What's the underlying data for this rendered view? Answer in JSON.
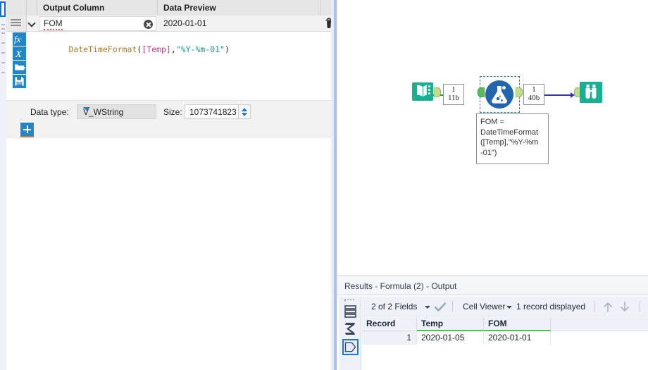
{
  "config_panel": {
    "grid_headers": [
      "Output Column",
      "Data Preview"
    ],
    "row": {
      "output_column": "FOM",
      "data_preview": "2020-01-01",
      "clear_icon": "clear-circle-icon",
      "delete_icon": "trash-icon",
      "expand_icon": "chevron-down-icon",
      "drag_icon": "drag-handle-icon"
    },
    "tool_buttons": [
      {
        "name": "function-button",
        "glyph": "fx"
      },
      {
        "name": "variable-button",
        "glyph": "X"
      },
      {
        "name": "open-folder-button",
        "glyph": "folder"
      },
      {
        "name": "save-button",
        "glyph": "floppy"
      }
    ],
    "formula": {
      "tokens": [
        {
          "text": "DateTimeFormat",
          "kind": "fn"
        },
        {
          "text": "(",
          "kind": "pn"
        },
        {
          "text": "[Temp]",
          "kind": "fld"
        },
        {
          "text": ",",
          "kind": "pn"
        },
        {
          "text": "\"%Y-%m-01\"",
          "kind": "str"
        },
        {
          "text": ")",
          "kind": "pn"
        }
      ],
      "plain": "DateTimeFormat([Temp],\"%Y-%m-01\")"
    },
    "data_type_label": "Data type:",
    "data_type_value": "V_WString",
    "size_label": "Size:",
    "size_value": "1073741823",
    "add_button_label": "+"
  },
  "canvas": {
    "nodes": [
      {
        "name": "text-input-tool",
        "icon": "book-icon",
        "color": "#18b092"
      },
      {
        "name": "formula-tool",
        "icon": "flask-icon",
        "color": "#2166ac",
        "selected": true
      },
      {
        "name": "browse-tool",
        "icon": "binoculars-icon",
        "color": "#18b092"
      }
    ],
    "connection_labels": [
      {
        "name": "connection-label-1",
        "records": "1",
        "size": "11b"
      },
      {
        "name": "connection-label-2",
        "records": "1",
        "size": "40b"
      }
    ],
    "annotation": "FOM =\nDateTimeFormat\n([Temp],\"%Y-%m\n-01\")",
    "wire_colors": {
      "first": "#2da24a",
      "second": "#3333cc"
    }
  },
  "results": {
    "title": "Results - Formula (2) - Output",
    "side_icons": [
      {
        "name": "records-view-icon",
        "selected": false
      },
      {
        "name": "summary-sigma-icon",
        "selected": false
      },
      {
        "name": "metadata-field-icon",
        "selected": true
      }
    ],
    "toolbar": {
      "fields_label": "2 of 2 Fields",
      "check_icon": "checkmark-icon",
      "cell_viewer_label": "Cell Viewer",
      "records_label": "1 record displayed",
      "up_icon": "arrow-up-icon",
      "down_icon": "arrow-down-icon"
    },
    "table": {
      "columns": [
        "Record",
        "Temp",
        "FOM"
      ],
      "rows": [
        {
          "record": "1",
          "temp": "2020-01-05",
          "fom": "2020-01-01"
        }
      ]
    }
  }
}
